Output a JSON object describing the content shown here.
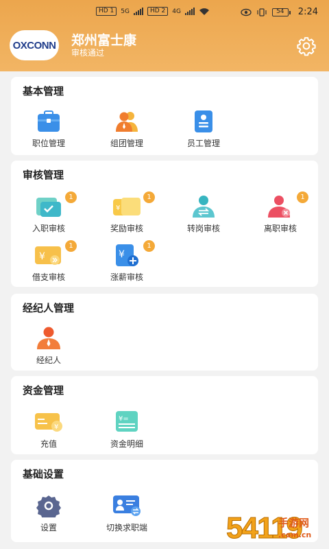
{
  "status_bar": {
    "sim1": "HD 1",
    "sim2": "HD 2",
    "net1": "5G",
    "net2": "4G",
    "battery": "54",
    "time": "2:24"
  },
  "header": {
    "logo_text": "OXCONN",
    "company": "郑州富士康",
    "status": "审核通过"
  },
  "sections": {
    "basic": {
      "title": "基本管理",
      "items": [
        {
          "label": "职位管理"
        },
        {
          "label": "组团管理"
        },
        {
          "label": "员工管理"
        }
      ]
    },
    "review": {
      "title": "审核管理",
      "items": [
        {
          "label": "入职审核",
          "badge": "1"
        },
        {
          "label": "奖励审核",
          "badge": "1"
        },
        {
          "label": "转岗审核"
        },
        {
          "label": "离职审核",
          "badge": "1"
        },
        {
          "label": "借支审核",
          "badge": "1"
        },
        {
          "label": "涨薪审核",
          "badge": "1"
        }
      ]
    },
    "agent": {
      "title": "经纪人管理",
      "items": [
        {
          "label": "经纪人"
        }
      ]
    },
    "funds": {
      "title": "资金管理",
      "items": [
        {
          "label": "充值"
        },
        {
          "label": "资金明细"
        }
      ]
    },
    "settings": {
      "title": "基础设置",
      "items": [
        {
          "label": "设置"
        },
        {
          "label": "切换求职端"
        }
      ]
    }
  },
  "watermark": {
    "number": "54119",
    "cn": "手游网",
    "url": ".com.cn"
  },
  "colors": {
    "header": "#eca64d",
    "badge": "#f4a938",
    "background": "#f2f2f2"
  }
}
